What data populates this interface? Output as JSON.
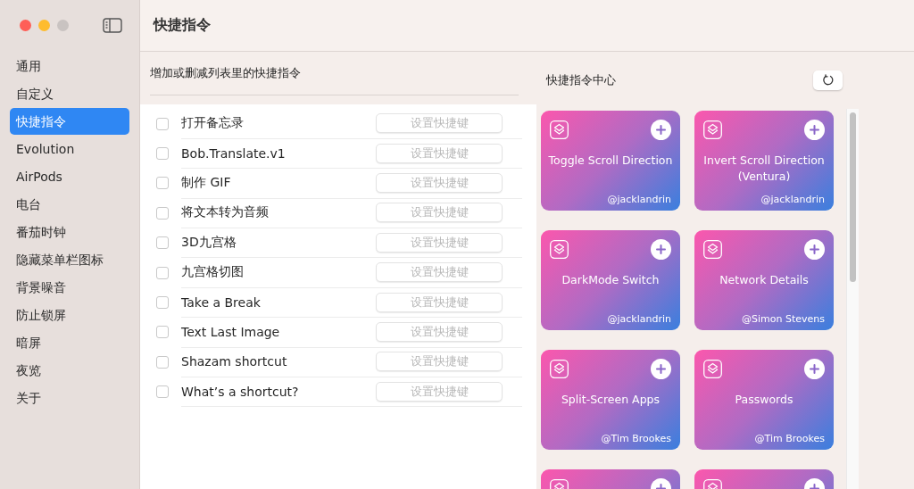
{
  "window": {
    "title": "快捷指令",
    "controls": [
      {
        "kind": "close",
        "disabled": false
      },
      {
        "kind": "minimize",
        "disabled": false
      },
      {
        "kind": "zoom",
        "disabled": true
      }
    ]
  },
  "sidebar": {
    "items": [
      {
        "label": "通用",
        "selected": false
      },
      {
        "label": "自定义",
        "selected": false
      },
      {
        "label": "快捷指令",
        "selected": true
      },
      {
        "label": "Evolution",
        "selected": false
      },
      {
        "label": "AirPods",
        "selected": false
      },
      {
        "label": "电台",
        "selected": false
      },
      {
        "label": "番茄时钟",
        "selected": false
      },
      {
        "label": "隐藏菜单栏图标",
        "selected": false
      },
      {
        "label": "背景噪音",
        "selected": false
      },
      {
        "label": "防止锁屏",
        "selected": false
      },
      {
        "label": "暗屏",
        "selected": false
      },
      {
        "label": "夜览",
        "selected": false
      },
      {
        "label": "关于",
        "selected": false
      }
    ]
  },
  "shortcut_list": {
    "heading": "增加或删减列表里的快捷指令",
    "rows": [
      {
        "name": "打开备忘录",
        "checked": false,
        "button": {
          "label": "设置快捷键",
          "disabled": true
        }
      },
      {
        "name": "Bob.Translate.v1",
        "checked": false,
        "button": {
          "label": "设置快捷键",
          "disabled": true
        }
      },
      {
        "name": "制作 GIF",
        "checked": false,
        "button": {
          "label": "设置快捷键",
          "disabled": true
        }
      },
      {
        "name": "将文本转为音频",
        "checked": false,
        "button": {
          "label": "设置快捷键",
          "disabled": true
        }
      },
      {
        "name": "3D九宫格",
        "checked": false,
        "button": {
          "label": "设置快捷键",
          "disabled": true
        }
      },
      {
        "name": "九宫格切图",
        "checked": false,
        "button": {
          "label": "设置快捷键",
          "disabled": true
        }
      },
      {
        "name": "Take a Break",
        "checked": false,
        "button": {
          "label": "设置快捷键",
          "disabled": true
        }
      },
      {
        "name": "Text Last Image",
        "checked": false,
        "button": {
          "label": "设置快捷键",
          "disabled": true
        }
      },
      {
        "name": "Shazam shortcut",
        "checked": false,
        "button": {
          "label": "设置快捷键",
          "disabled": true
        }
      },
      {
        "name": "What’s a shortcut?",
        "checked": false,
        "button": {
          "label": "设置快捷键",
          "disabled": true
        }
      }
    ]
  },
  "gallery": {
    "heading": "快捷指令中心",
    "cards": [
      {
        "kind": "full",
        "title": "Toggle Scroll Direction",
        "author": "@jacklandrin"
      },
      {
        "kind": "full",
        "title": "Invert Scroll Direction (Ventura)",
        "author": "@jacklandrin"
      },
      {
        "kind": "full",
        "title": "DarkMode Switch",
        "author": "@jacklandrin"
      },
      {
        "kind": "full",
        "title": "Network Details",
        "author": "@Simon Stevens"
      },
      {
        "kind": "full",
        "title": "Split-Screen Apps",
        "author": "@Tim Brookes"
      },
      {
        "kind": "full",
        "title": "Passwords",
        "author": "@Tim Brookes"
      },
      {
        "kind": "cut_off"
      },
      {
        "kind": "cut_off"
      }
    ]
  }
}
